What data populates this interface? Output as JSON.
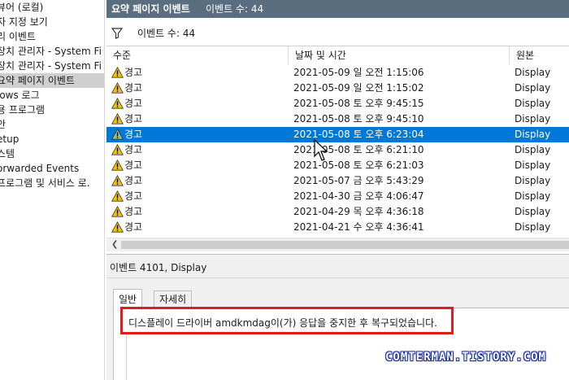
{
  "sidebar": {
    "items": [
      {
        "label": "뷰어 (로컬)",
        "selected": false
      },
      {
        "label": "자 지정 보기",
        "selected": false
      },
      {
        "label": "리 이벤트",
        "selected": false
      },
      {
        "label": "장치 관리자 - System Fi",
        "selected": false
      },
      {
        "label": "장치 관리자 - System Fi",
        "selected": false
      },
      {
        "label": "요약 페이지 이벤트",
        "selected": true
      },
      {
        "label": "lows 로그",
        "selected": false
      },
      {
        "label": "용 프로그램",
        "selected": false
      },
      {
        "label": "안",
        "selected": false
      },
      {
        "label": "etup",
        "selected": false
      },
      {
        "label": "스템",
        "selected": false
      },
      {
        "label": "orwarded Events",
        "selected": false
      },
      {
        "label": "프로그램 및 서비스 로.",
        "selected": false
      }
    ]
  },
  "header": {
    "title": "요약 페이지 이벤트",
    "count": "이벤트 수: 44"
  },
  "filter": {
    "label": "이벤트 수: 44",
    "icon": "funnel-icon"
  },
  "list": {
    "columns": [
      "수준",
      "날짜 및 시간",
      "원본"
    ],
    "rows": [
      {
        "level": "경고",
        "datetime": "2021-05-09 일 오전 1:15:06",
        "source": "Display"
      },
      {
        "level": "경고",
        "datetime": "2021-05-09 일 오전 1:15:02",
        "source": "Display"
      },
      {
        "level": "경고",
        "datetime": "2021-05-08 토 오후 9:45:15",
        "source": "Display"
      },
      {
        "level": "경고",
        "datetime": "2021-05-08 토 오후 9:45:10",
        "source": "Display"
      },
      {
        "level": "경고",
        "datetime": "2021-05-08 토 오후 6:23:04",
        "source": "Display"
      },
      {
        "level": "경고",
        "datetime": "2021-05-08 토 오후 6:21:10",
        "source": "Display"
      },
      {
        "level": "경고",
        "datetime": "2021-05-08 토 오후 6:21:03",
        "source": "Display"
      },
      {
        "level": "경고",
        "datetime": "2021-05-07 금 오후 5:43:29",
        "source": "Display"
      },
      {
        "level": "경고",
        "datetime": "2021-04-30 금 오후 4:06:47",
        "source": "Display"
      },
      {
        "level": "경고",
        "datetime": "2021-04-29 목 오후 4:36:18",
        "source": "Display"
      },
      {
        "level": "경고",
        "datetime": "2021-04-21 수 오후 4:36:41",
        "source": "Display"
      }
    ],
    "selected_row": 4,
    "warning_color": "#f5c400",
    "selection_color": "#0078d7"
  },
  "detail": {
    "title": "이벤트 4101, Display",
    "tabs": [
      "일반",
      "자세히"
    ],
    "active_tab": "일반",
    "message": "디스플레이 드라이버 amdkmdag이(가) 응답을 중지한 후 복구되었습니다.",
    "highlight_color": "#e41b1b"
  },
  "watermark": "COMTERMAN.TISTORY.COM"
}
